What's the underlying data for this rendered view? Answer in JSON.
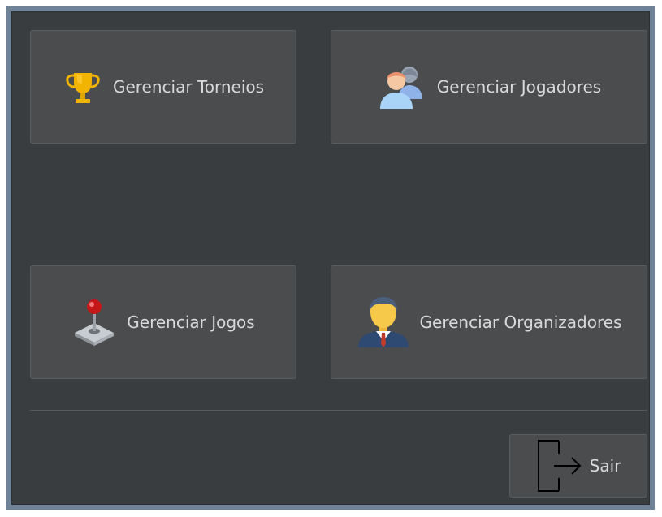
{
  "menu": {
    "torneios_label": "Gerenciar Torneios",
    "jogadores_label": "Gerenciar Jogadores",
    "jogos_label": "Gerenciar Jogos",
    "organizadores_label": "Gerenciar Organizadores",
    "sair_label": "Sair"
  },
  "icons": {
    "torneios": "trophy-icon",
    "jogadores": "users-icon",
    "jogos": "joystick-icon",
    "organizadores": "businessman-icon",
    "sair": "exit-door-icon"
  },
  "colors": {
    "window_border": "#6f8296",
    "panel_bg": "#3a3d40",
    "button_bg": "#4a4c4e",
    "label_text": "#d9d9d9"
  }
}
